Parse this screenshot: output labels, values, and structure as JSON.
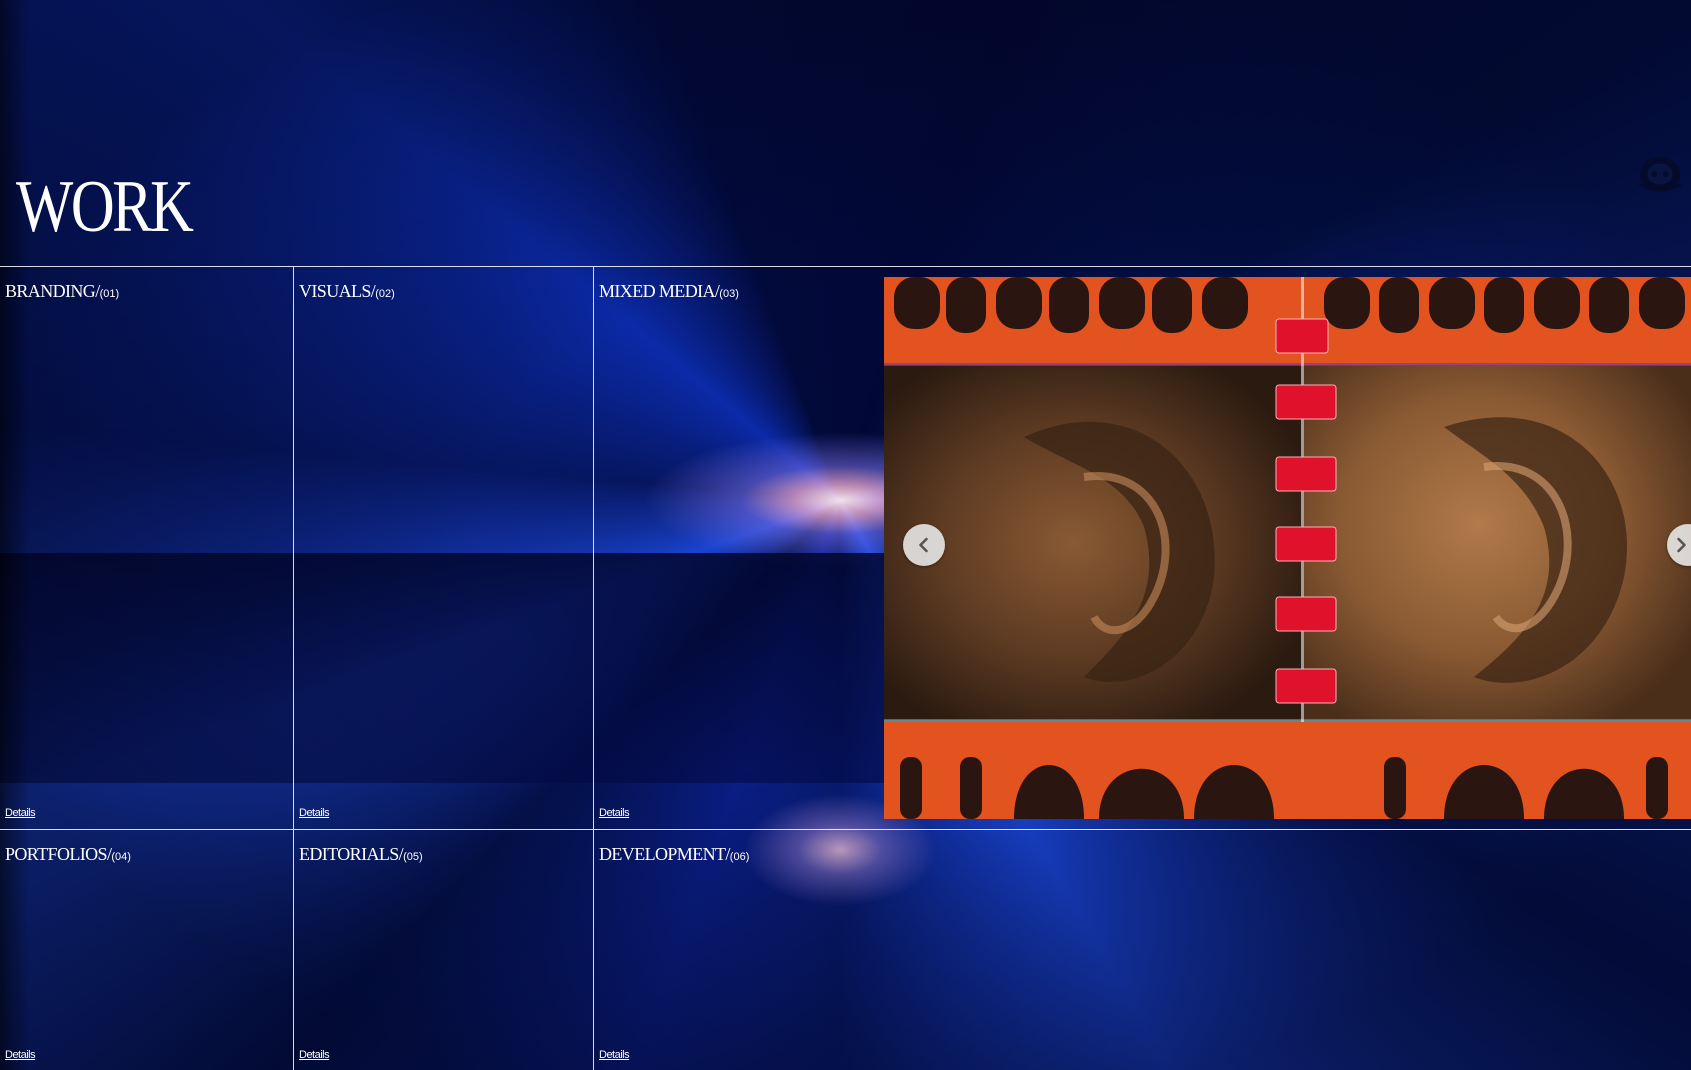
{
  "page": {
    "title": "WORK"
  },
  "categories": [
    {
      "name": "BRANDING/",
      "number": "(01)",
      "details": "Details"
    },
    {
      "name": "VISUALS/",
      "number": "(02)",
      "details": "Details"
    },
    {
      "name": "MIXED MEDIA/",
      "number": "(03)",
      "details": "Details"
    },
    {
      "name": "PORTFOLIOS/",
      "number": "(04)",
      "details": "Details"
    },
    {
      "name": "EDITORIALS/",
      "number": "(05)",
      "details": "Details"
    },
    {
      "name": "DEVELOPMENT/",
      "number": "(06)",
      "details": "Details"
    }
  ],
  "carousel": {
    "prev_icon": "chevron-left-icon",
    "next_icon": "chevron-right-icon"
  },
  "colors": {
    "background": "#020a3a",
    "accent_blue": "#1a44d0",
    "text": "#ffffff",
    "artwork_orange": "#e2531f"
  }
}
